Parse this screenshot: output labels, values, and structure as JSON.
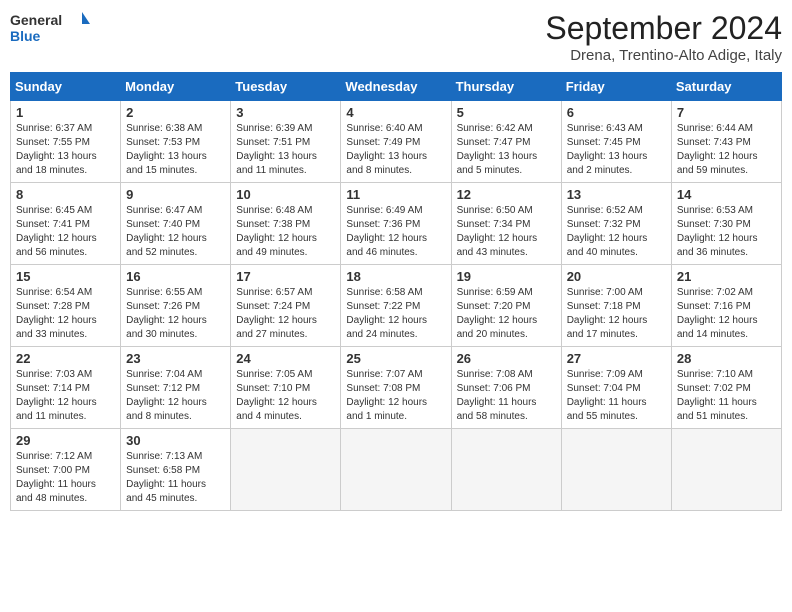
{
  "logo": {
    "line1": "General",
    "line2": "Blue"
  },
  "title": "September 2024",
  "location": "Drena, Trentino-Alto Adige, Italy",
  "weekdays": [
    "Sunday",
    "Monday",
    "Tuesday",
    "Wednesday",
    "Thursday",
    "Friday",
    "Saturday"
  ],
  "weeks": [
    [
      {
        "day": "1",
        "sunrise": "6:37 AM",
        "sunset": "7:55 PM",
        "daylight": "13 hours and 18 minutes."
      },
      {
        "day": "2",
        "sunrise": "6:38 AM",
        "sunset": "7:53 PM",
        "daylight": "13 hours and 15 minutes."
      },
      {
        "day": "3",
        "sunrise": "6:39 AM",
        "sunset": "7:51 PM",
        "daylight": "13 hours and 11 minutes."
      },
      {
        "day": "4",
        "sunrise": "6:40 AM",
        "sunset": "7:49 PM",
        "daylight": "13 hours and 8 minutes."
      },
      {
        "day": "5",
        "sunrise": "6:42 AM",
        "sunset": "7:47 PM",
        "daylight": "13 hours and 5 minutes."
      },
      {
        "day": "6",
        "sunrise": "6:43 AM",
        "sunset": "7:45 PM",
        "daylight": "13 hours and 2 minutes."
      },
      {
        "day": "7",
        "sunrise": "6:44 AM",
        "sunset": "7:43 PM",
        "daylight": "12 hours and 59 minutes."
      }
    ],
    [
      {
        "day": "8",
        "sunrise": "6:45 AM",
        "sunset": "7:41 PM",
        "daylight": "12 hours and 56 minutes."
      },
      {
        "day": "9",
        "sunrise": "6:47 AM",
        "sunset": "7:40 PM",
        "daylight": "12 hours and 52 minutes."
      },
      {
        "day": "10",
        "sunrise": "6:48 AM",
        "sunset": "7:38 PM",
        "daylight": "12 hours and 49 minutes."
      },
      {
        "day": "11",
        "sunrise": "6:49 AM",
        "sunset": "7:36 PM",
        "daylight": "12 hours and 46 minutes."
      },
      {
        "day": "12",
        "sunrise": "6:50 AM",
        "sunset": "7:34 PM",
        "daylight": "12 hours and 43 minutes."
      },
      {
        "day": "13",
        "sunrise": "6:52 AM",
        "sunset": "7:32 PM",
        "daylight": "12 hours and 40 minutes."
      },
      {
        "day": "14",
        "sunrise": "6:53 AM",
        "sunset": "7:30 PM",
        "daylight": "12 hours and 36 minutes."
      }
    ],
    [
      {
        "day": "15",
        "sunrise": "6:54 AM",
        "sunset": "7:28 PM",
        "daylight": "12 hours and 33 minutes."
      },
      {
        "day": "16",
        "sunrise": "6:55 AM",
        "sunset": "7:26 PM",
        "daylight": "12 hours and 30 minutes."
      },
      {
        "day": "17",
        "sunrise": "6:57 AM",
        "sunset": "7:24 PM",
        "daylight": "12 hours and 27 minutes."
      },
      {
        "day": "18",
        "sunrise": "6:58 AM",
        "sunset": "7:22 PM",
        "daylight": "12 hours and 24 minutes."
      },
      {
        "day": "19",
        "sunrise": "6:59 AM",
        "sunset": "7:20 PM",
        "daylight": "12 hours and 20 minutes."
      },
      {
        "day": "20",
        "sunrise": "7:00 AM",
        "sunset": "7:18 PM",
        "daylight": "12 hours and 17 minutes."
      },
      {
        "day": "21",
        "sunrise": "7:02 AM",
        "sunset": "7:16 PM",
        "daylight": "12 hours and 14 minutes."
      }
    ],
    [
      {
        "day": "22",
        "sunrise": "7:03 AM",
        "sunset": "7:14 PM",
        "daylight": "12 hours and 11 minutes."
      },
      {
        "day": "23",
        "sunrise": "7:04 AM",
        "sunset": "7:12 PM",
        "daylight": "12 hours and 8 minutes."
      },
      {
        "day": "24",
        "sunrise": "7:05 AM",
        "sunset": "7:10 PM",
        "daylight": "12 hours and 4 minutes."
      },
      {
        "day": "25",
        "sunrise": "7:07 AM",
        "sunset": "7:08 PM",
        "daylight": "12 hours and 1 minute."
      },
      {
        "day": "26",
        "sunrise": "7:08 AM",
        "sunset": "7:06 PM",
        "daylight": "11 hours and 58 minutes."
      },
      {
        "day": "27",
        "sunrise": "7:09 AM",
        "sunset": "7:04 PM",
        "daylight": "11 hours and 55 minutes."
      },
      {
        "day": "28",
        "sunrise": "7:10 AM",
        "sunset": "7:02 PM",
        "daylight": "11 hours and 51 minutes."
      }
    ],
    [
      {
        "day": "29",
        "sunrise": "7:12 AM",
        "sunset": "7:00 PM",
        "daylight": "11 hours and 48 minutes."
      },
      {
        "day": "30",
        "sunrise": "7:13 AM",
        "sunset": "6:58 PM",
        "daylight": "11 hours and 45 minutes."
      },
      null,
      null,
      null,
      null,
      null
    ]
  ]
}
